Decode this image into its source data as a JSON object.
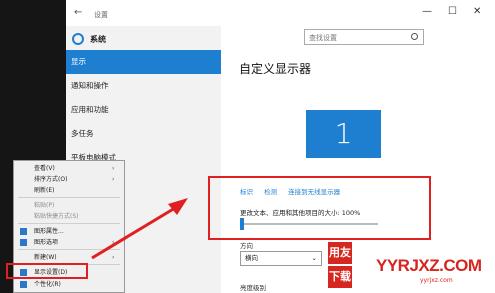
{
  "window": {
    "title": "设置",
    "back_glyph": "←",
    "brand": "系统",
    "controls": [
      "—",
      "☐",
      "✕"
    ]
  },
  "search": {
    "placeholder": "查找设置"
  },
  "sidebar": {
    "items": [
      {
        "label": "显示",
        "active": true
      },
      {
        "label": "通知和操作"
      },
      {
        "label": "应用和功能"
      },
      {
        "label": "多任务"
      },
      {
        "label": "平板电脑模式"
      }
    ]
  },
  "main": {
    "title": "自定义显示器",
    "monitor_number": "1",
    "links": [
      "标识",
      "检测",
      "连接到无线显示器"
    ],
    "scale_label": "更改文本、应用和其他项目的大小: 100%",
    "slider_value_percent": 100,
    "orientation_label": "方向",
    "orientation_value": "横向",
    "brightness_label": "亮度级别"
  },
  "context_menu": {
    "items": [
      {
        "label": "查看(V)",
        "has_submenu": true
      },
      {
        "label": "排序方式(O)",
        "has_submenu": true
      },
      {
        "label": "刷新(E)"
      },
      {
        "divider": true
      },
      {
        "label": "粘贴(P)",
        "disabled": true
      },
      {
        "label": "粘贴快捷方式(S)",
        "disabled": true
      },
      {
        "divider": true
      },
      {
        "label": "图形属性...",
        "icon": "graphics-icon"
      },
      {
        "label": "图形选项",
        "icon": "graphics-icon",
        "has_submenu": true
      },
      {
        "divider": true
      },
      {
        "label": "新建(W)",
        "has_submenu": true
      },
      {
        "divider": true
      },
      {
        "label": "显示设置(D)",
        "icon": "display-icon",
        "highlighted": true
      },
      {
        "label": "个性化(R)",
        "icon": "personalize-icon"
      }
    ]
  },
  "watermark": {
    "box1": "用友",
    "box2": "下载",
    "big": "YYRJXZ.COM",
    "small": "yyrjxz.com"
  },
  "colors": {
    "accent": "#1E7FD1",
    "highlight_red": "#E02020"
  }
}
